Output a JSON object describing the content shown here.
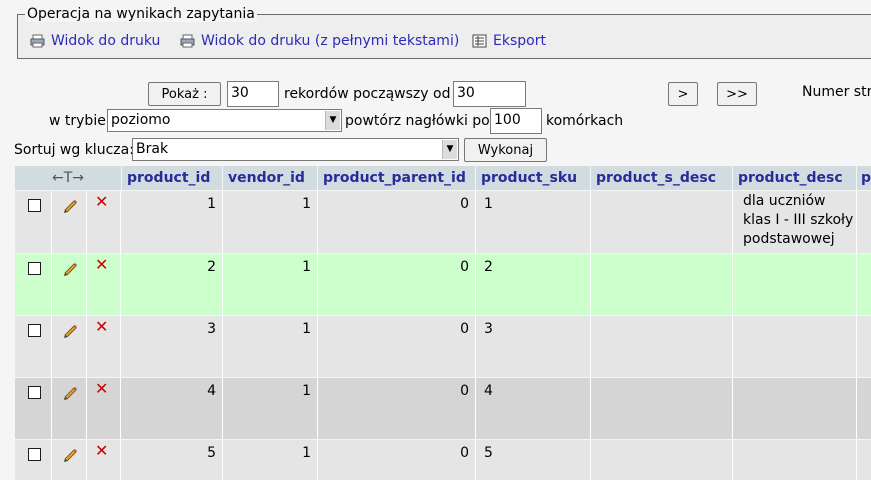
{
  "operations": {
    "legend": "Operacja na wynikach zapytania",
    "print_view": "Widok do druku",
    "print_view_full": "Widok do druku (z pełnymi tekstami)",
    "export": "Eksport"
  },
  "nav": {
    "show_button": "Pokaż :",
    "rows_value": "30",
    "rows_from_label": "rekordów począwszy od",
    "start_value": "30",
    "next_button": ">",
    "last_button": ">>",
    "page_number_label": "Numer strony:",
    "mode_label": "w trybie",
    "mode_value": "poziomo",
    "repeat_label": "powtórz nagłówki po",
    "repeat_value": "100",
    "cells_label": "komórkach",
    "sort_label": "Sortuj wg klucza:",
    "sort_value": "Brak",
    "execute_button": "Wykonaj"
  },
  "table": {
    "nav_header": "←T→",
    "columns": [
      "product_id",
      "vendor_id",
      "product_parent_id",
      "product_sku",
      "product_s_desc",
      "product_desc",
      "p"
    ],
    "rows": [
      {
        "product_id": "1",
        "vendor_id": "1",
        "product_parent_id": "0",
        "product_sku": "1",
        "product_s_desc": "",
        "product_desc": "dla uczniów klas I - III szkoły podstawowej"
      },
      {
        "product_id": "2",
        "vendor_id": "1",
        "product_parent_id": "0",
        "product_sku": "2",
        "product_s_desc": "",
        "product_desc": ""
      },
      {
        "product_id": "3",
        "vendor_id": "1",
        "product_parent_id": "0",
        "product_sku": "3",
        "product_s_desc": "",
        "product_desc": ""
      },
      {
        "product_id": "4",
        "vendor_id": "1",
        "product_parent_id": "0",
        "product_sku": "4",
        "product_s_desc": "",
        "product_desc": ""
      },
      {
        "product_id": "5",
        "vendor_id": "1",
        "product_parent_id": "0",
        "product_sku": "5",
        "product_s_desc": "",
        "product_desc": ""
      }
    ]
  },
  "colors": {
    "header_bg": "#d0dce0",
    "header_text": "#2a2a99",
    "row_odd": "#e5e5e5",
    "row_even": "#d5d5d5",
    "row_highlight": "#ccffcc",
    "link": "#2b2bb8",
    "delete": "#cc0000"
  },
  "icons": [
    "print-icon",
    "print-full-icon",
    "export-icon",
    "edit-pencil-icon",
    "delete-cross-icon"
  ]
}
